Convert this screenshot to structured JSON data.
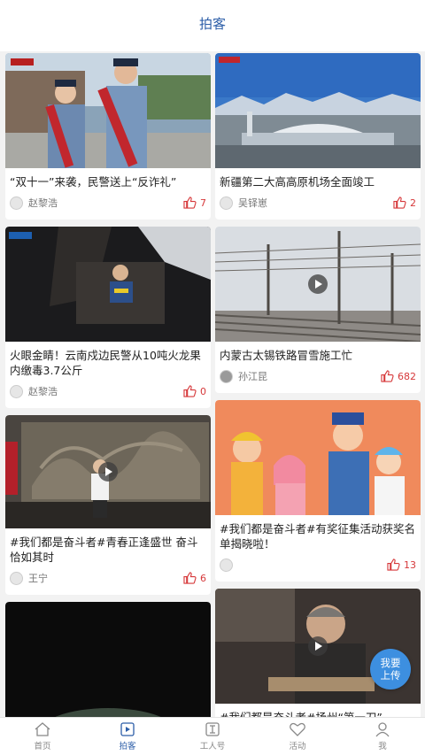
{
  "header": {
    "title": "拍客"
  },
  "cards": {
    "c1": {
      "title": "“双十一”来袭，民警送上“反诈礼”",
      "author": "赵黎浩",
      "likes": "7"
    },
    "c2": {
      "title": "新疆第二大高高原机场全面竣工",
      "author": "吴铎崽",
      "likes": "2"
    },
    "c3": {
      "title": "火眼金睛！云南戍边民警从10吨火龙果内缴毒3.7公斤",
      "author": "赵黎浩",
      "likes": "0"
    },
    "c4": {
      "title": "内蒙古太锡铁路冒雪施工忙",
      "author": "孙江昆",
      "likes": "682"
    },
    "c5": {
      "title": "#我们都是奋斗者#青春正逢盛世 奋斗恰如其时",
      "author": "王宁",
      "likes": "6"
    },
    "c6": {
      "title": "#我们都是奋斗者#有奖征集活动获奖名单揭晓啦！",
      "author": "",
      "likes": "13"
    },
    "c7": {
      "title": "",
      "author": "",
      "likes": ""
    },
    "c8": {
      "title": "#我们都是奋斗者#扬州“第一刀”",
      "author": "",
      "likes": ""
    }
  },
  "upload_button": {
    "label_line1": "我要",
    "label_line2": "上传"
  },
  "tabbar": {
    "tabs": [
      {
        "label": "首页",
        "icon": "home-icon"
      },
      {
        "label": "拍客",
        "icon": "video-icon",
        "active": true
      },
      {
        "label": "工人号",
        "icon": "worker-icon"
      },
      {
        "label": "活动",
        "icon": "heart-icon"
      },
      {
        "label": "我",
        "icon": "user-icon"
      }
    ]
  },
  "colors": {
    "accent": "#2c5ea8",
    "like": "#d6383a",
    "upload": "#3d8fe0"
  }
}
